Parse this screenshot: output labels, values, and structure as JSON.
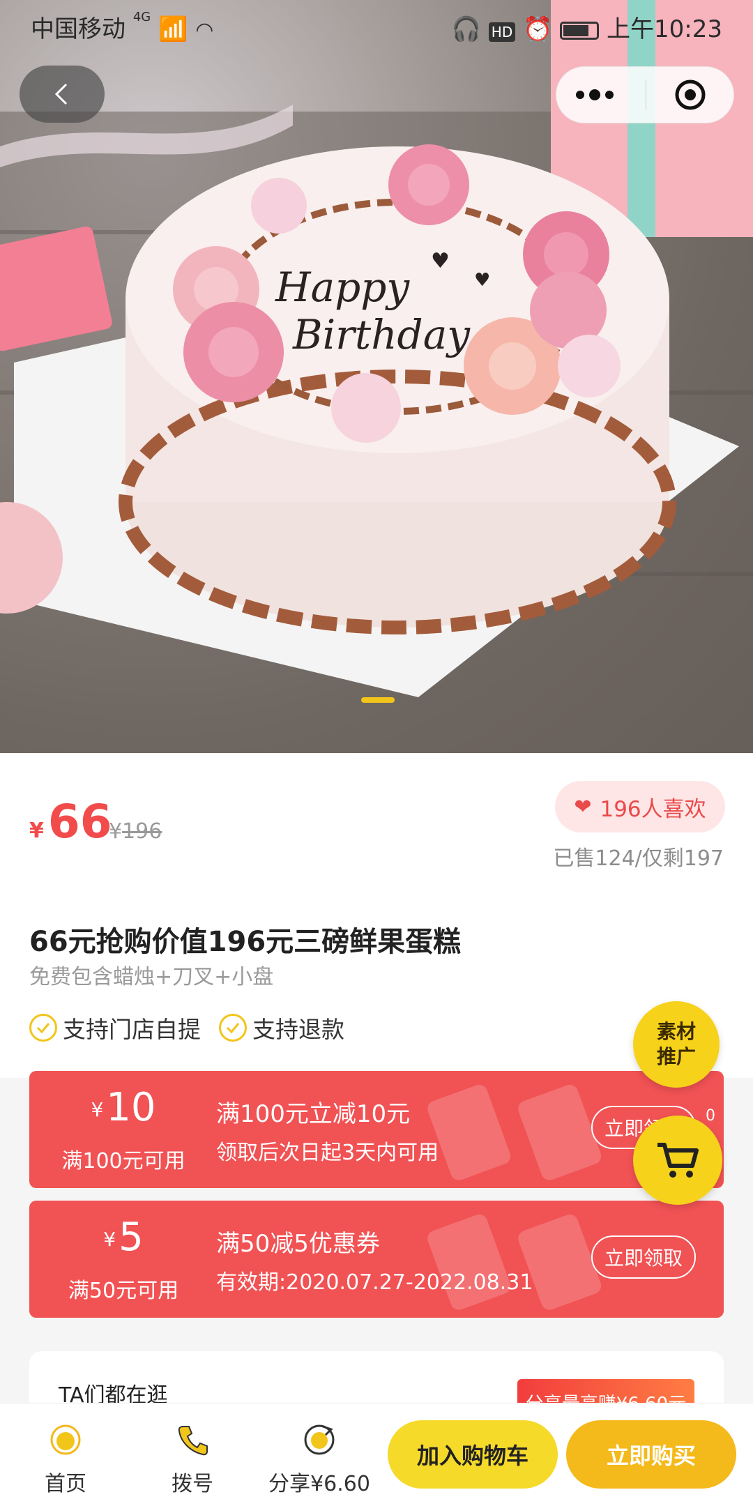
{
  "status_bar": {
    "carrier": "中国移动",
    "network": "4G",
    "time": "上午10:23"
  },
  "product": {
    "price_symbol": "¥",
    "price": "66",
    "original_symbol": "¥",
    "original_price": "196",
    "likes": "196人喜欢",
    "sales": "已售124/仅剩197",
    "title": "66元抢购价值196元三磅鲜果蛋糕",
    "subtitle": "免费包含蜡烛+刀叉+小盘",
    "features": [
      "支持门店自提",
      "支持退款"
    ],
    "cake_text": [
      "Happy",
      "Birthday"
    ]
  },
  "coupons": [
    {
      "symbol": "¥",
      "amount": "10",
      "requirement": "满100元可用",
      "name": "满100元立减10元",
      "desc": "领取后次日起3天内可用",
      "button": "立即领取"
    },
    {
      "symbol": "¥",
      "amount": "5",
      "requirement": "满50元可用",
      "name": "满50减5优惠券",
      "desc": "有效期:2020.07.27-2022.08.31",
      "button": "立即领取"
    }
  ],
  "floating": {
    "promo_line1": "素材",
    "promo_line2": "推广",
    "cart_count": "0"
  },
  "related": {
    "label": "TA们都在逛",
    "share": "分享最高赚¥6.60元"
  },
  "bottom_bar": {
    "home": "首页",
    "dial": "拨号",
    "share": "分享¥6.60",
    "add_cart": "加入购物车",
    "buy_now": "立即购买"
  },
  "colors": {
    "accent_red": "#f24b4b",
    "coupon_red": "#f15254",
    "yellow": "#f7d21b",
    "orange": "#f4b91a"
  }
}
